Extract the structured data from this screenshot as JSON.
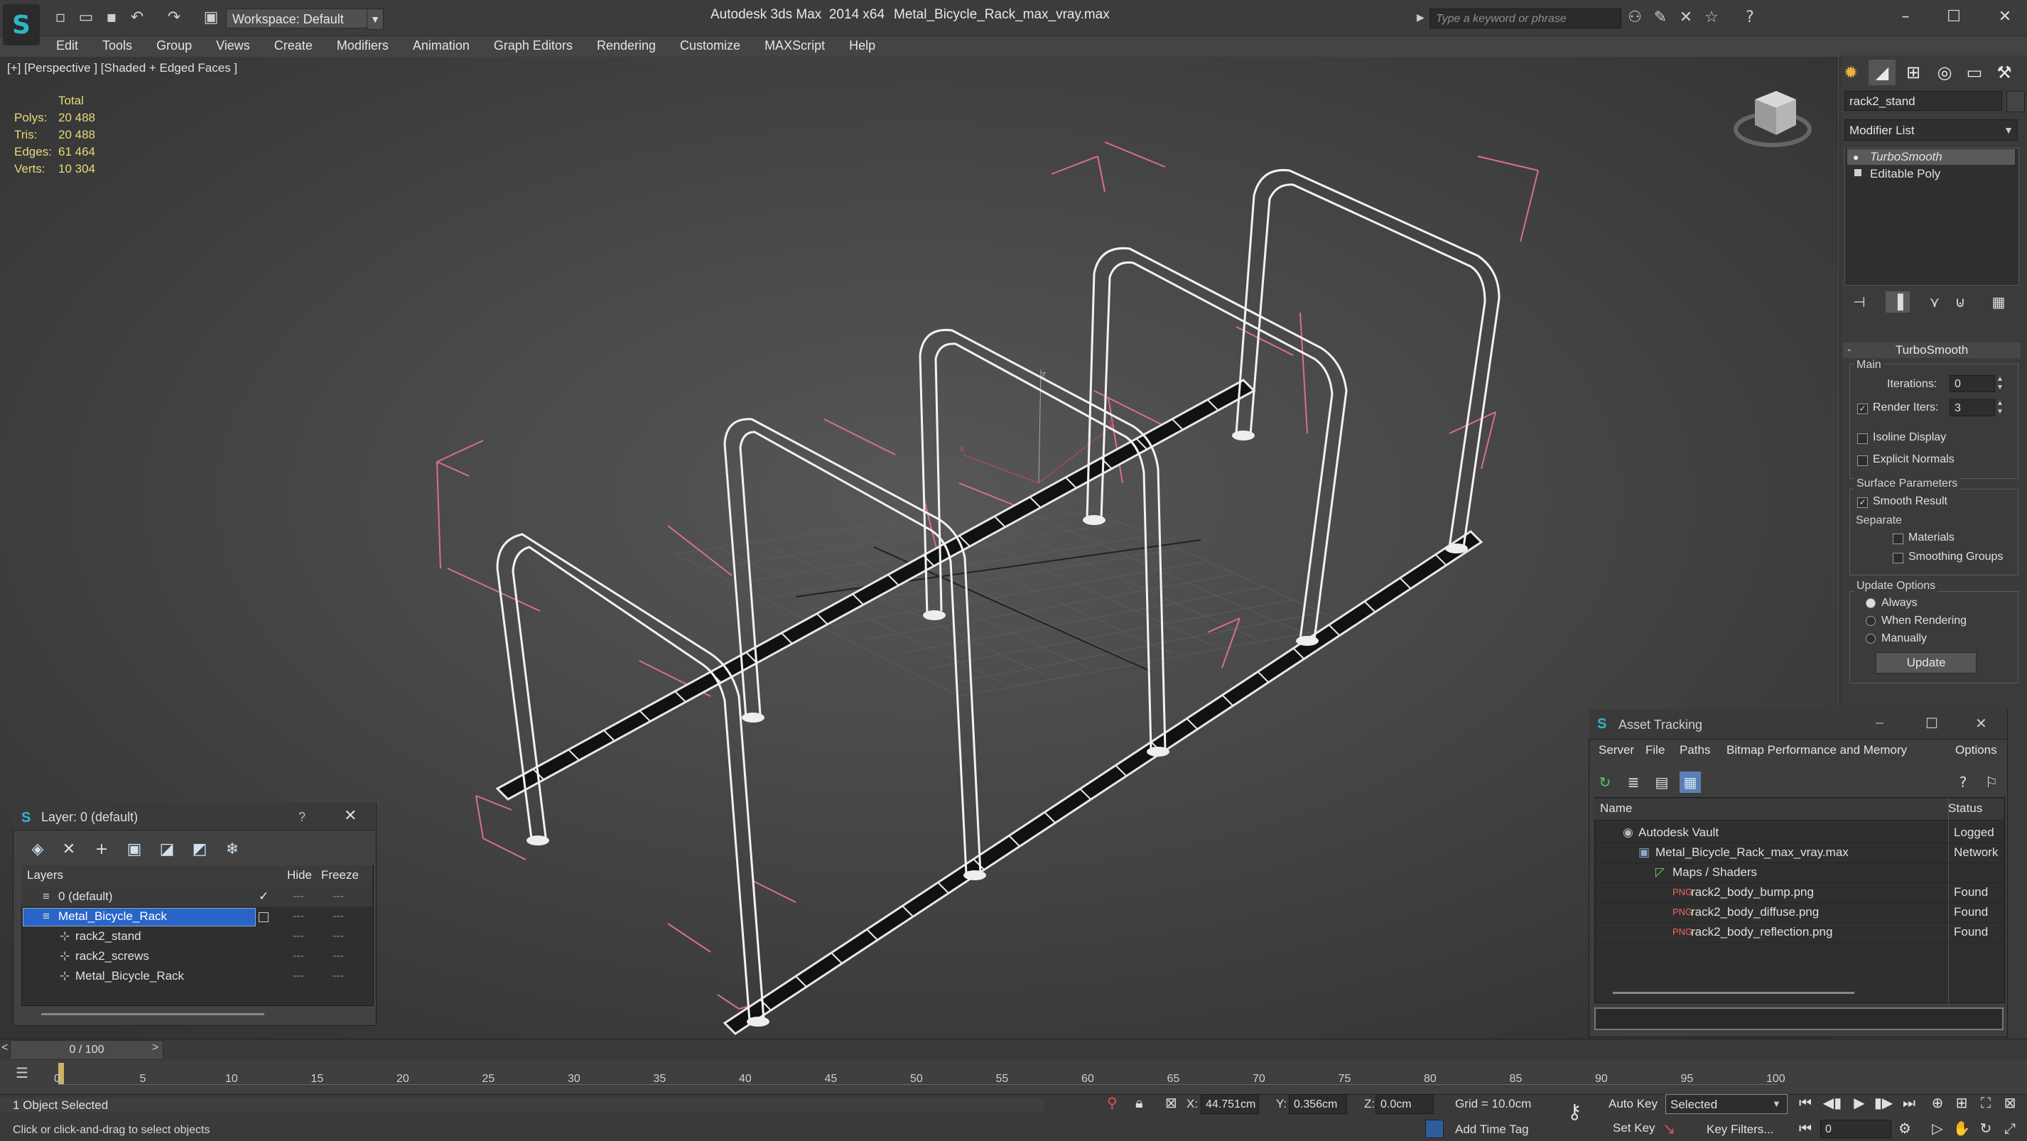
{
  "window": {
    "app_title": "Autodesk 3ds Max  2014 x64",
    "file_title": "Metal_Bicycle_Rack_max_vray.max",
    "workspace": "Workspace: Default",
    "search_placeholder": "Type a keyword or phrase"
  },
  "menus": [
    "Edit",
    "Tools",
    "Group",
    "Views",
    "Create",
    "Modifiers",
    "Animation",
    "Graph Editors",
    "Rendering",
    "Customize",
    "MAXScript",
    "Help"
  ],
  "viewport": {
    "label": "[+] [Perspective ] [Shaded + Edged Faces ]",
    "stats_header": "Total",
    "stats": [
      {
        "k": "Polys:",
        "v": "20 488"
      },
      {
        "k": "Tris:",
        "v": "20 488"
      },
      {
        "k": "Edges:",
        "v": "61 464"
      },
      {
        "k": "Verts:",
        "v": "10 304"
      }
    ],
    "axis_labels": {
      "z": "z",
      "x": "x",
      "y": "y"
    }
  },
  "command_panel": {
    "object_name": "rack2_stand",
    "modifier_list": "Modifier List",
    "stack": [
      "TurboSmooth",
      "Editable Poly"
    ],
    "rollout_title": "TurboSmooth",
    "main_group": "Main",
    "iterations_label": "Iterations:",
    "iterations_value": "0",
    "render_iters_label": "Render Iters:",
    "render_iters_value": "3",
    "render_iters_checked": true,
    "isoline_label": "Isoline Display",
    "explicit_normals_label": "Explicit Normals",
    "surface_group": "Surface Parameters",
    "smooth_result_label": "Smooth Result",
    "separate_label": "Separate",
    "materials_label": "Materials",
    "smoothing_groups_label": "Smoothing Groups",
    "update_group": "Update Options",
    "always_label": "Always",
    "when_rendering_label": "When Rendering",
    "manually_label": "Manually",
    "update_button": "Update"
  },
  "layer_dialog": {
    "title": "Layer: 0 (default)",
    "help": "?",
    "col_layers": "Layers",
    "col_hide": "Hide",
    "col_freeze": "Freeze",
    "rows": [
      {
        "name": "0 (default)",
        "indent": 0,
        "selected": false
      },
      {
        "name": "Metal_Bicycle_Rack",
        "indent": 0,
        "selected": true
      },
      {
        "name": "rack2_stand",
        "indent": 1,
        "selected": false
      },
      {
        "name": "rack2_screws",
        "indent": 1,
        "selected": false
      },
      {
        "name": "Metal_Bicycle_Rack",
        "indent": 1,
        "selected": false
      }
    ]
  },
  "asset_tracking": {
    "title": "Asset Tracking",
    "menus": [
      "Server",
      "File",
      "Paths",
      "Bitmap Performance and Memory",
      "Options"
    ],
    "col_name": "Name",
    "col_status": "Status",
    "rows": [
      {
        "name": "Autodesk Vault",
        "status": "Logged",
        "indent": 1
      },
      {
        "name": "Metal_Bicycle_Rack_max_vray.max",
        "status": "Network",
        "indent": 2
      },
      {
        "name": "Maps / Shaders",
        "status": "",
        "indent": 3
      },
      {
        "name": "rack2_body_bump.png",
        "status": "Found",
        "indent": 4
      },
      {
        "name": "rack2_body_diffuse.png",
        "status": "Found",
        "indent": 4
      },
      {
        "name": "rack2_body_reflection.png",
        "status": "Found",
        "indent": 4
      }
    ]
  },
  "timeline": {
    "frame": "0 / 100",
    "ticks": [
      "0",
      "5",
      "10",
      "15",
      "20",
      "25",
      "30",
      "35",
      "40",
      "45",
      "50",
      "55",
      "60",
      "65",
      "70",
      "75",
      "80",
      "85",
      "90",
      "95",
      "100"
    ]
  },
  "status": {
    "selection": "1 Object Selected",
    "prompt": "Click or click-and-drag to select objects",
    "x_label": "X:",
    "x_value": "44.751cm",
    "y_label": "Y:",
    "y_value": "0.356cm",
    "z_label": "Z:",
    "z_value": "0.0cm",
    "grid": "Grid = 10.0cm",
    "add_time_tag": "Add Time Tag",
    "auto_key": "Auto Key",
    "set_key": "Set Key",
    "selected": "Selected",
    "key_filters": "Key Filters...",
    "frame_field": "0"
  }
}
